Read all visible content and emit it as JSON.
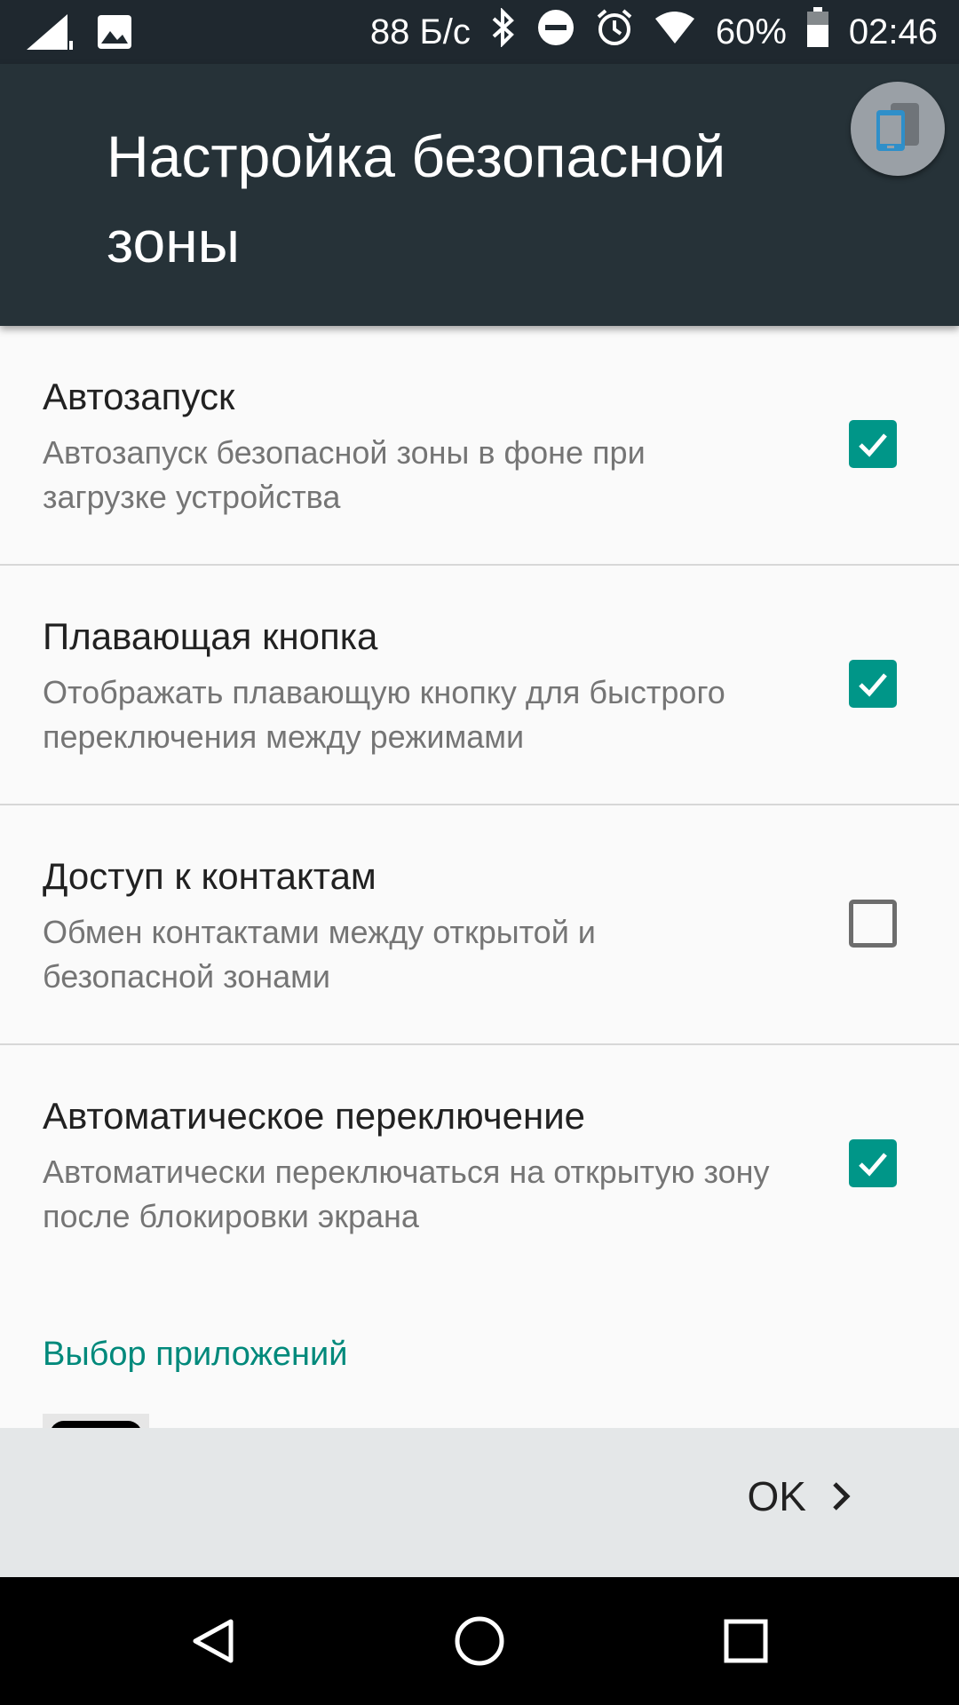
{
  "status_bar": {
    "speed": "88 Б/с",
    "battery": "60%",
    "time": "02:46",
    "icons": [
      "signal-icon",
      "image-icon",
      "bluetooth-icon",
      "dnd-icon",
      "alarm-icon",
      "wifi-icon",
      "battery-icon"
    ]
  },
  "header": {
    "title": "Настройка безопасной зоны",
    "floating_icon": "switch-mode-icon"
  },
  "settings": [
    {
      "title": "Автозапуск",
      "desc": "Автозапуск безопасной зоны в фоне при загрузке устройства",
      "checked": true
    },
    {
      "title": "Плавающая кнопка",
      "desc": "Отображать плавающую кнопку для быстрого переключения между режимами",
      "checked": true
    },
    {
      "title": "Доступ к контактам",
      "desc": "Обмен контактами между открытой и безопасной зонами",
      "checked": false
    },
    {
      "title": "Автоматическое переключение",
      "desc": "Автоматически переключаться на открытую зону после блокировки экрана",
      "checked": true
    }
  ],
  "section": {
    "title": "Выбор приложений"
  },
  "footer": {
    "ok_label": "OK"
  },
  "colors": {
    "appbar": "#263238",
    "accent": "#009688",
    "section": "#00897b"
  },
  "nav": {
    "icons": [
      "back-icon",
      "home-icon",
      "recents-icon"
    ]
  }
}
